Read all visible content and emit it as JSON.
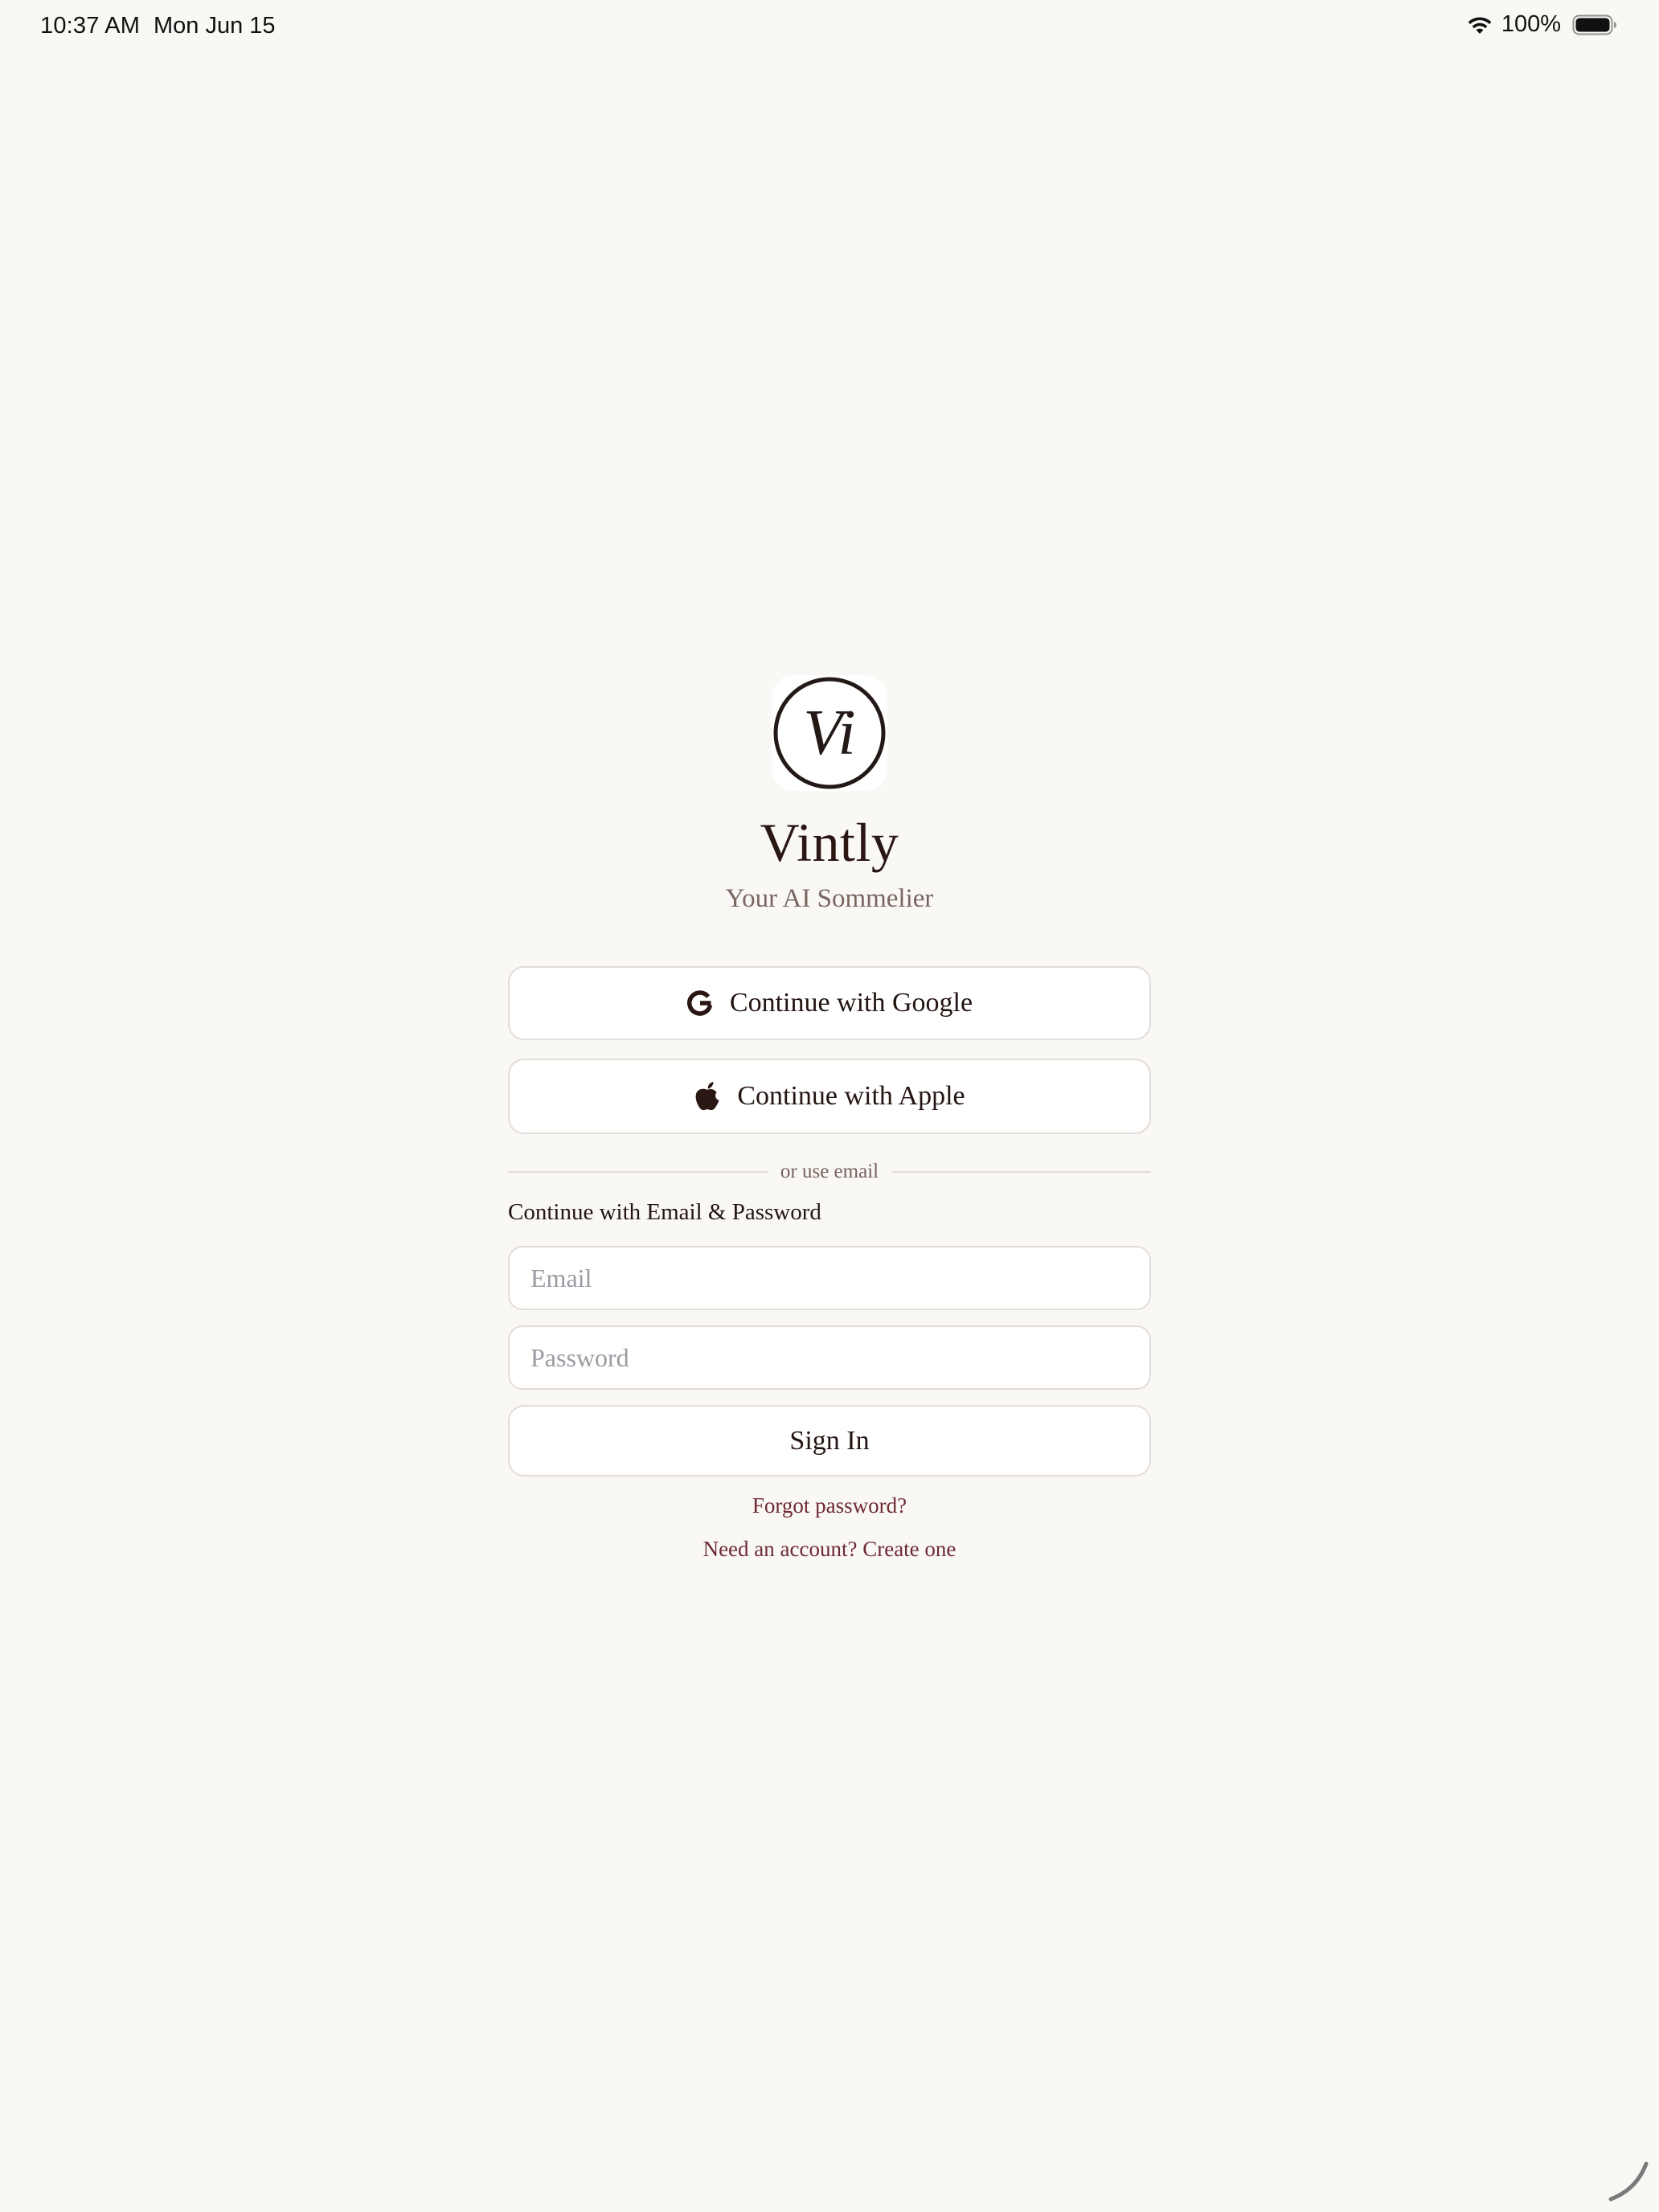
{
  "status_bar": {
    "time": "10:37 AM",
    "date": "Mon Jun 15",
    "battery_percent": "100%",
    "wifi_icon": "wifi-icon",
    "battery_icon": "battery-full-icon"
  },
  "brand": {
    "logo_monogram": "Vi",
    "title": "Vintly",
    "subtitle": "Your AI Sommelier"
  },
  "auth": {
    "google_button_label": "Continue with Google",
    "apple_button_label": "Continue with Apple",
    "divider_text": "or use email",
    "email_section_label": "Continue with Email & Password",
    "email_placeholder": "Email",
    "email_value": "",
    "password_placeholder": "Password",
    "password_value": "",
    "sign_in_label": "Sign In",
    "forgot_password_label": "Forgot password?",
    "create_account_label": "Need an account? Create one"
  },
  "colors": {
    "background": "#f9f8f5",
    "text_primary": "#2a1714",
    "text_secondary": "#7a6661",
    "link_accent": "#6e2a33",
    "border": "#e3dcd9"
  }
}
